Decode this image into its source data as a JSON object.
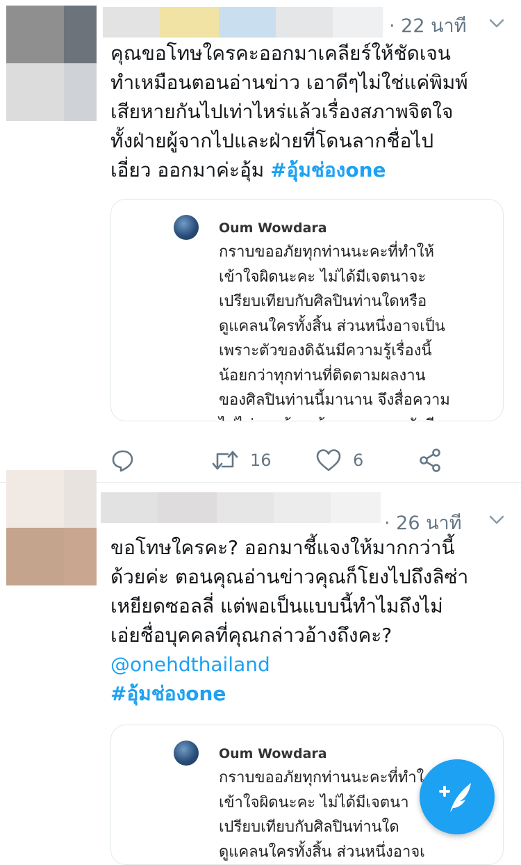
{
  "tweets": [
    {
      "time": "· 22 นาที",
      "body_lines": [
        "คุณขอโทษใครคะออกมาเคลียร์ให้ชัดเจน",
        "ทำเหมือนตอนอ่านข่าว  เอาดีๆไม่ใช่แค่พิมพ์",
        "เสียหายกันไปเท่าไหร่แล้วเรื่องสภาพจิตใจ",
        "ทั้งฝ่ายผู้จากไปและฝ่ายที่โดนลากชื่อไป"
      ],
      "body_last_plain": "เอี่ยว ออกมาค่ะอุ้ม ",
      "hashtag": "#อุ้มช่องone",
      "quote": {
        "author": "Oum Wowdara",
        "lines": [
          "กราบขออภัยทุกท่านนะคะที่ทำให้",
          "เข้าใจผิดนะคะ ไม่ได้มีเจตนาจะ",
          "เปรียบเทียบกับศิลปินท่านใดหรือ",
          "ดูแคลนใครทั้งสิ้น ส่วนหนึ่งอาจเป็น",
          "เพราะตัวของดิฉันมีความรู้เรื่องนี้",
          "น้อยกว่าทุกท่านที่ติดตามผลงาน",
          "ของศิลปินท่านนี้มานาน จึงสื่อความ",
          "ไปไม่ครบถ้วน ต้องกราบขออภัยอีก"
        ]
      },
      "actions": {
        "retweets": "16",
        "likes": "6"
      }
    },
    {
      "time": "· 26 นาที",
      "body_lines": [
        "ขอโทษใครคะ? ออกมาชี้แจงให้มากกว่านี้",
        "ด้วยค่ะ ตอนคุณอ่านข่าวคุณก็โยงไปถึงลิซ่า",
        "เหยียดซอลลี่ แต่พอเป็นแบบนี้ทำไมถึงไม่",
        "เอ่ยชื่อบุคคลที่คุณกล่าวอ้างถึงคะ?"
      ],
      "mention": "@onehdthailand",
      "hashtag": "#อุ้มช่องone",
      "quote": {
        "author": "Oum Wowdara",
        "lines": [
          "กราบขออภัยทุกท่านนะคะที่ทำใ",
          "เข้าใจผิดนะคะ ไม่ได้มีเจตนา",
          "เปรียบเทียบกับศิลปินท่านใด",
          "ดูแคลนใครทั้งสิ้น ส่วนหนึ่งอาจเ"
        ]
      }
    }
  ],
  "icons": {
    "reply": "reply-icon",
    "retweet": "retweet-icon",
    "like": "heart-icon",
    "share": "share-icon",
    "compose": "compose-tweet-icon",
    "menu": "chevron-down-icon"
  },
  "colors": {
    "accent": "#1da1f2",
    "text": "#14171a",
    "muted": "#657786"
  }
}
